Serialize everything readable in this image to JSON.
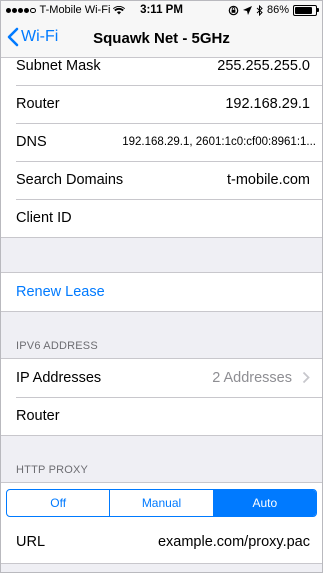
{
  "status_bar": {
    "carrier": "T-Mobile Wi-Fi",
    "time": "3:11 PM",
    "battery": "86%",
    "battery_level": 0.86
  },
  "nav": {
    "back_label": "Wi-Fi",
    "title": "Squawk Net - 5GHz"
  },
  "ipv4": {
    "rows": [
      {
        "label": "Subnet Mask",
        "value": "255.255.255.0"
      },
      {
        "label": "Router",
        "value": "192.168.29.1"
      },
      {
        "label": "DNS",
        "value": "192.168.29.1, 2601:1c0:cf00:8961:1..."
      },
      {
        "label": "Search Domains",
        "value": "t-mobile.com"
      },
      {
        "label": "Client ID",
        "value": ""
      }
    ]
  },
  "renew": {
    "label": "Renew Lease"
  },
  "ipv6": {
    "header": "IPV6 ADDRESS",
    "ip_label": "IP Addresses",
    "ip_value": "2 Addresses",
    "router_label": "Router"
  },
  "proxy": {
    "header": "HTTP PROXY",
    "options": [
      "Off",
      "Manual",
      "Auto"
    ],
    "selected": "Auto",
    "url_label": "URL",
    "url_value": "example.com/proxy.pac"
  }
}
